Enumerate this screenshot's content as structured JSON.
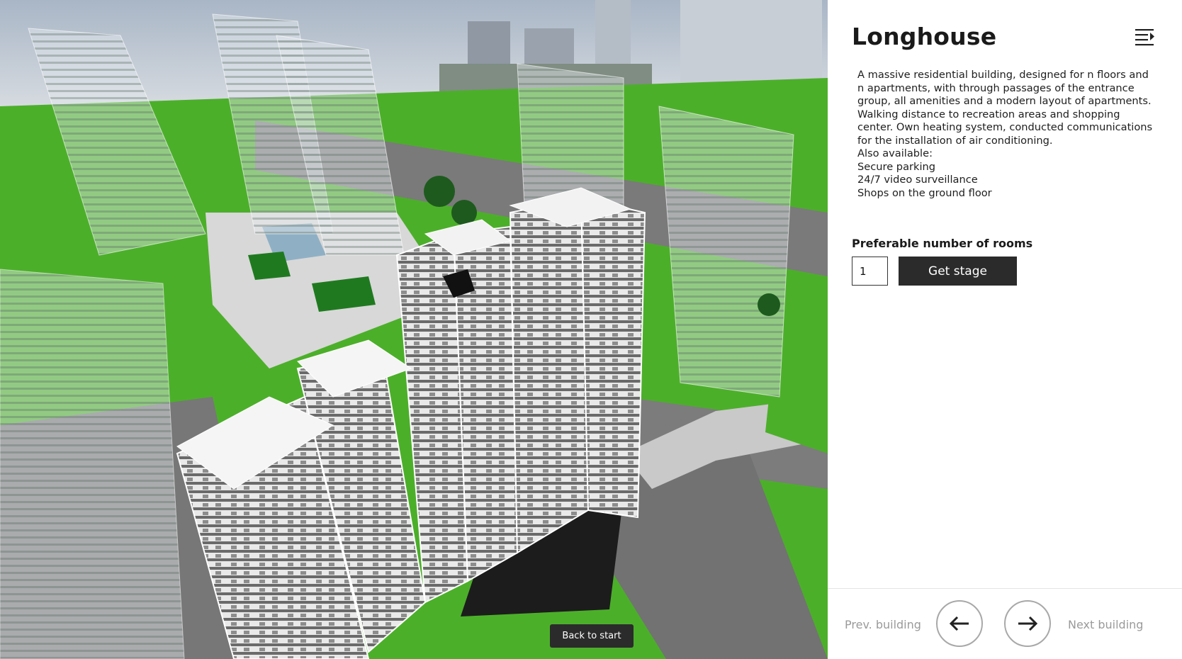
{
  "viewport": {
    "back_label": "Back to start"
  },
  "panel": {
    "title": "Longhouse",
    "menu_icon": "menu-list-icon",
    "description": [
      "A massive residential building, designed for n floors and n apartments, with through passages of the entrance group, all amenities and a modern layout of apartments. Walking distance to recreation areas and shopping center. Own heating system, conducted communications for the installation of air conditioning.",
      "Also available:",
      "Secure parking",
      "24/7 video surveillance",
      "Shops on the ground floor"
    ],
    "rooms_label": "Preferable number of rooms",
    "rooms_value": "1",
    "get_stage_label": "Get stage"
  },
  "nav": {
    "prev_label": "Prev. building",
    "next_label": "Next building",
    "prev_icon": "arrow-left-icon",
    "next_icon": "arrow-right-icon"
  },
  "colors": {
    "dark_button": "#2b2b2b",
    "grass": "#4caf2a",
    "muted_text": "#9a9a9a"
  }
}
